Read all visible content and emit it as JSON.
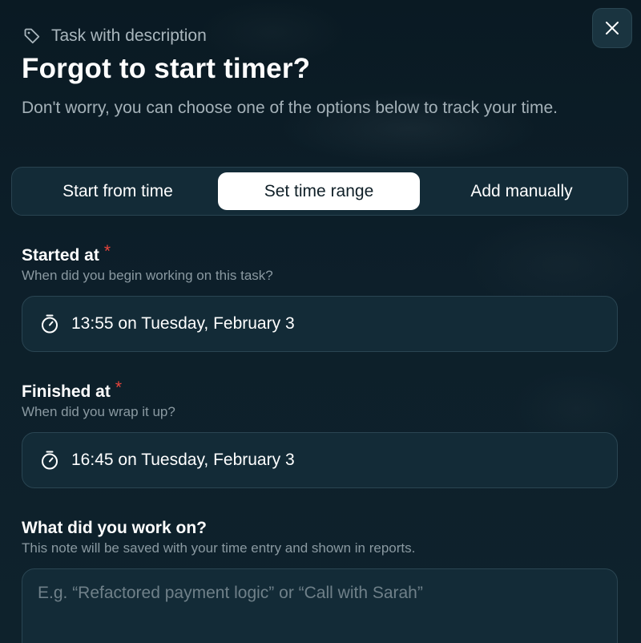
{
  "dialog": {
    "close_icon": "close-icon",
    "task_icon": "tag-icon",
    "task_name": "Task with description",
    "title": "Forgot to start timer?",
    "subtitle": "Don't worry, you can choose one of the options below to track your time."
  },
  "tabs": {
    "items": [
      {
        "label": "Start from time",
        "active": false
      },
      {
        "label": "Set time range",
        "active": true
      },
      {
        "label": "Add manually",
        "active": false
      }
    ]
  },
  "started": {
    "label": "Started at",
    "required_mark": "*",
    "help": "When did you begin working on this task?",
    "icon": "stopwatch-icon",
    "value": "13:55 on Tuesday, February 3"
  },
  "finished": {
    "label": "Finished at",
    "required_mark": "*",
    "help": "When did you wrap it up?",
    "icon": "stopwatch-icon",
    "value": "16:45 on Tuesday, February 3"
  },
  "note": {
    "label": "What did you work on?",
    "help": "This note will be saved with your time entry and shown in reports.",
    "value": "",
    "placeholder": "E.g. “Refactored payment logic” or “Call with Sarah”"
  },
  "colors": {
    "background": "#0c1d27",
    "surface": "#132b37",
    "border": "#2a4552",
    "active_tab": "#ffffff",
    "required": "#e8453c",
    "muted_text": "#8a99a1"
  }
}
